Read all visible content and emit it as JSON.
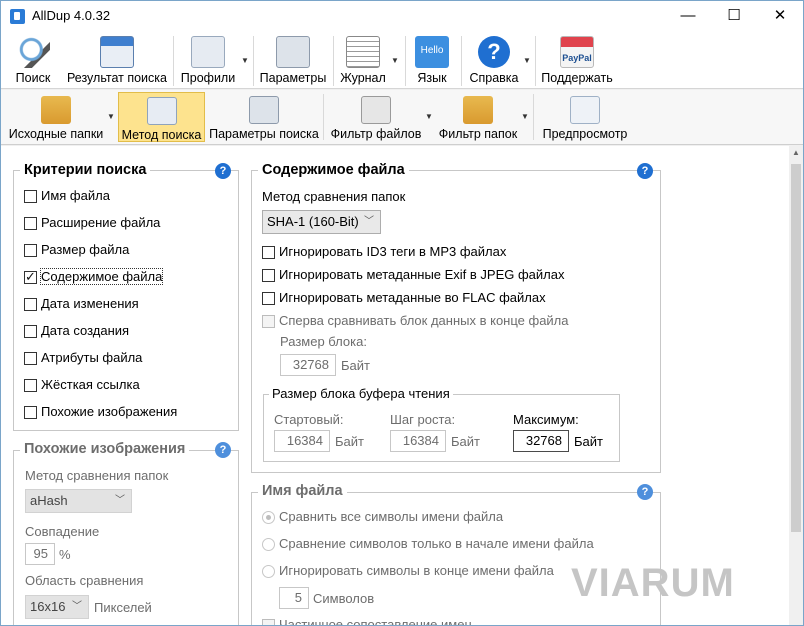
{
  "window": {
    "title": "AllDup 4.0.32"
  },
  "titlebar_buttons": {
    "minimize": "—",
    "maximize": "☐",
    "close": "✕"
  },
  "toolbar1": [
    {
      "label": "Поиск",
      "icon": "magnifier-icon"
    },
    {
      "label": "Результат поиска",
      "icon": "save-results-icon"
    },
    {
      "label": "Профили",
      "icon": "profiles-icon"
    },
    {
      "label": "Параметры",
      "icon": "settings-icon"
    },
    {
      "label": "Журнал",
      "icon": "log-icon"
    },
    {
      "label": "Язык",
      "icon": "language-icon",
      "icon_text": "Hello"
    },
    {
      "label": "Справка",
      "icon": "help-icon",
      "icon_text": "?"
    },
    {
      "label": "Поддержать",
      "icon": "paypal-icon",
      "icon_text": "PayPal"
    }
  ],
  "toolbar2": [
    {
      "label": "Исходные папки",
      "icon": "source-folders-icon"
    },
    {
      "label": "Метод поиска",
      "icon": "search-method-icon",
      "active": true
    },
    {
      "label": "Параметры поиска",
      "icon": "search-params-icon"
    },
    {
      "label": "Фильтр файлов",
      "icon": "file-filter-icon"
    },
    {
      "label": "Фильтр папок",
      "icon": "folder-filter-icon"
    },
    {
      "label": "Предпросмотр",
      "icon": "preview-icon"
    }
  ],
  "criteria": {
    "title": "Критерии поиска",
    "items": [
      {
        "label": "Имя файла",
        "checked": false
      },
      {
        "label": "Расширение файла",
        "checked": false
      },
      {
        "label": "Размер файла",
        "checked": false
      },
      {
        "label": "Содержимое файла",
        "checked": true
      },
      {
        "label": "Дата изменения",
        "checked": false
      },
      {
        "label": "Дата создания",
        "checked": false
      },
      {
        "label": "Атрибуты файла",
        "checked": false
      },
      {
        "label": "Жёсткая ссылка",
        "checked": false
      },
      {
        "label": "Похожие изображения",
        "checked": false
      }
    ]
  },
  "similar": {
    "title": "Похожие изображения",
    "method_label": "Метод сравнения папок",
    "method_value": "aHash",
    "match_label": "Совпадение",
    "match_value": "95",
    "match_unit": "%",
    "area_label": "Область сравнения",
    "area_value": "16x16",
    "area_unit": "Пикселей"
  },
  "content": {
    "title": "Содержимое файла",
    "method_label": "Метод сравнения папок",
    "method_value": "SHA-1 (160-Bit)",
    "options": [
      "Игнорировать ID3 теги в MP3 файлах",
      "Игнорировать метаданные Exif в JPEG файлах",
      "Игнорировать метаданные во FLAC файлах"
    ],
    "compare_end": "Сперва сравнивать блок данных в конце файла",
    "block_size_label": "Размер блока:",
    "block_size_value": "32768",
    "bytes": "Байт",
    "buffer": {
      "title": "Размер блока буфера чтения",
      "start_label": "Стартовый:",
      "start_value": "16384",
      "step_label": "Шаг роста:",
      "step_value": "16384",
      "max_label": "Максимум:",
      "max_value": "32768"
    }
  },
  "filename": {
    "title": "Имя файла",
    "radios": [
      {
        "label": "Сравнить все символы имени файла",
        "selected": true
      },
      {
        "label": "Сравнение символов только в начале имени файла",
        "selected": false
      },
      {
        "label": "Игнорировать символы в конце имени файла",
        "selected": false
      }
    ],
    "chars_value": "5",
    "chars_unit": "Символов",
    "partial": "Частичное сопоставление имен"
  },
  "watermark": "VIARUM"
}
